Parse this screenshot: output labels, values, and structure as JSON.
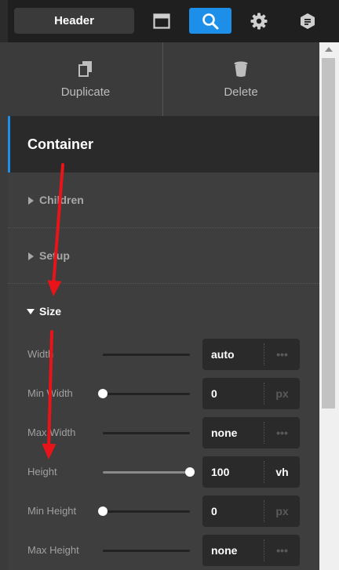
{
  "toolbar": {
    "header_label": "Header",
    "icons": [
      "layout-icon",
      "search-icon",
      "gear-icon",
      "hexagon-badge-icon"
    ],
    "active_icon": "search-icon",
    "accent": "#1e8fe8"
  },
  "actions": {
    "duplicate_label": "Duplicate",
    "delete_label": "Delete"
  },
  "element": {
    "title": "Container"
  },
  "sections": {
    "children": "Children",
    "setup": "Setup",
    "size": "Size"
  },
  "size_props": [
    {
      "label": "Width",
      "value": "auto",
      "unit": "•••",
      "slider": 0.5
    },
    {
      "label": "Min Width",
      "value": "0",
      "unit": "px",
      "slider": 0
    },
    {
      "label": "Max Width",
      "value": "none",
      "unit": "•••",
      "slider": 0.5
    },
    {
      "label": "Height",
      "value": "100",
      "unit": "vh",
      "slider": 1
    },
    {
      "label": "Min Height",
      "value": "0",
      "unit": "px",
      "slider": 0
    },
    {
      "label": "Max Height",
      "value": "none",
      "unit": "•••",
      "slider": 0.5
    }
  ],
  "annotation_color": "#e8141a"
}
